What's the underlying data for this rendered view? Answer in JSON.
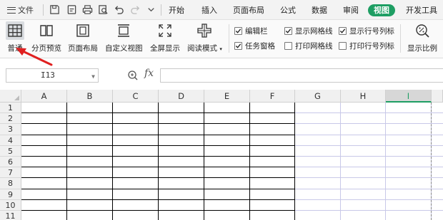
{
  "quick_access": {
    "menu_label": "文件"
  },
  "tabs": [
    {
      "label": "开始"
    },
    {
      "label": "插入"
    },
    {
      "label": "页面布局"
    },
    {
      "label": "公式"
    },
    {
      "label": "数据"
    },
    {
      "label": "审阅"
    },
    {
      "label": "视图",
      "active": true
    },
    {
      "label": "开发工具"
    }
  ],
  "ribbon": {
    "buttons": {
      "normal": "普通",
      "page_break": "分页预览",
      "page_layout": "页面布局",
      "custom_view": "自定义视图",
      "full_screen": "全屏显示",
      "reading_mode": "阅读模式",
      "zoom": "显示比例"
    },
    "checkboxes": {
      "edit_bar": {
        "label": "编辑栏",
        "checked": true
      },
      "task_pane": {
        "label": "任务窗格",
        "checked": true
      },
      "show_gridlines": {
        "label": "显示网格线",
        "checked": true
      },
      "print_gridlines": {
        "label": "打印网格线",
        "checked": false
      },
      "show_headings": {
        "label": "显示行号列标",
        "checked": true
      },
      "print_headings": {
        "label": "打印行号列标",
        "checked": false
      }
    }
  },
  "formula_bar": {
    "cell_ref": "I13",
    "fx_label": "fx",
    "value": ""
  },
  "sheet": {
    "columns": [
      "A",
      "B",
      "C",
      "D",
      "E",
      "F",
      "G",
      "H",
      "I"
    ],
    "selected_column": "I",
    "rows": [
      "1",
      "2",
      "3",
      "4",
      "5",
      "6",
      "7",
      "8",
      "9",
      "10",
      "11"
    ]
  },
  "colors": {
    "accent": "#1e9e63",
    "annotation_arrow": "#e02020",
    "gridline": "#c8c8e8",
    "table_border": "#000000"
  }
}
